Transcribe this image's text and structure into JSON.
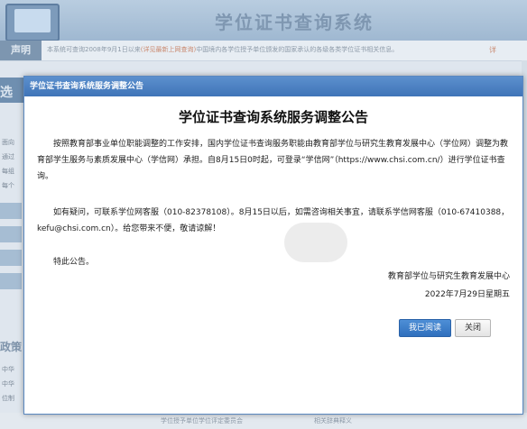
{
  "background": {
    "site_title": "学位证书查询系统",
    "notice_tab": "声明",
    "notice_text_a": "本系统可查询2008年9月1日以来",
    "notice_link": "(详见最新上网查询)",
    "notice_text_b": "中国境内各学位授予单位颁发的国家承认的各级各类学位证书相关信息。",
    "notice_more": "详",
    "left_tag": "选",
    "left_lines": [
      "面向",
      "通过",
      "每组",
      "每个"
    ],
    "policy_title": "政策",
    "policy_lines": [
      "中华",
      "中华",
      "位制"
    ],
    "footer_links": [
      "学位授予单位学位评定委员会",
      "相关辞典释义"
    ]
  },
  "modal": {
    "window_title": "学位证书查询系统服务调整公告",
    "notice_title": "学位证书查询系统服务调整公告",
    "paragraphs": [
      "按照教育部事业单位职能调整的工作安排，国内学位证书查询服务职能由教育部学位与研究生教育发展中心（学位网）调整为教育部学生服务与素质发展中心（学信网）承担。自8月15日0时起，可登录“学信网”（https://www.chsi.com.cn/）进行学位证书查询。",
      "如有疑问，可联系学位网客服（010-82378108）。8月15日以后，如需咨询相关事宜，请联系学信网客服（010-67410388，kefu@chsi.com.cn）。给您带来不便，敬请谅解！",
      "特此公告。"
    ],
    "sign_org": "教育部学位与研究生教育发展中心",
    "sign_date": "2022年7月29日星期五",
    "read_button": "我已阅读",
    "close_button": "关闭"
  }
}
